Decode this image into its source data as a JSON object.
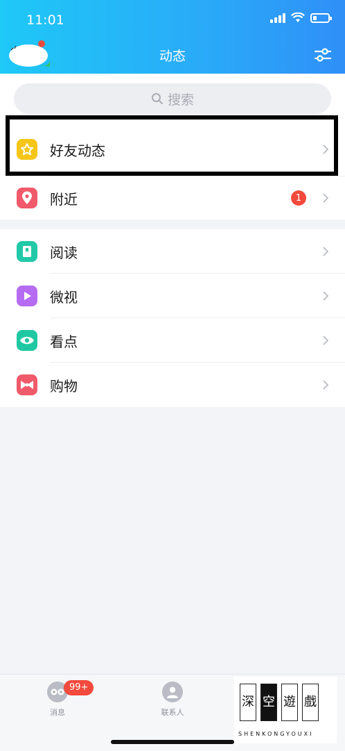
{
  "status_bar": {
    "time": "11:01"
  },
  "header": {
    "title": "动态",
    "filter_icon": "filter-sliders-icon"
  },
  "search": {
    "placeholder": "搜索",
    "icon": "search-icon"
  },
  "groups": [
    {
      "items": [
        {
          "label": "好友动态",
          "icon": "star-icon",
          "color": "#f5c518",
          "highlighted": true
        },
        {
          "label": "附近",
          "icon": "location-pin-icon",
          "color": "#f05a6a",
          "badge": "1"
        }
      ]
    },
    {
      "items": [
        {
          "label": "阅读",
          "icon": "book-icon",
          "color": "#22c9a8"
        },
        {
          "label": "微视",
          "icon": "play-icon",
          "color": "#b56cf0"
        },
        {
          "label": "看点",
          "icon": "eye-icon",
          "color": "#1fc8a2"
        },
        {
          "label": "购物",
          "icon": "bow-icon",
          "color": "#f05a6a"
        }
      ]
    }
  ],
  "tabbar": {
    "tabs": [
      {
        "label": "消息",
        "icon": "message-face-icon",
        "badge": "99+"
      },
      {
        "label": "联系人",
        "icon": "contact-person-icon"
      }
    ]
  },
  "watermark": {
    "chars": [
      "深",
      "空",
      "遊",
      "戲"
    ],
    "subtitle": "SHENKONGYOUXI"
  },
  "colors": {
    "header_start": "#1ec8f7",
    "header_end": "#2f8ff8",
    "badge": "#f24a3d"
  }
}
